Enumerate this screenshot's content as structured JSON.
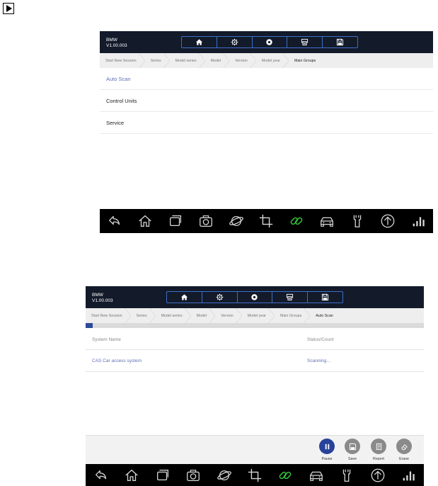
{
  "screens": [
    {
      "brand": {
        "name": "BMW",
        "version": "V1.00.003"
      },
      "toolbar": [
        "home-icon",
        "settings-icon",
        "record-icon",
        "print-icon",
        "save-icon"
      ],
      "breadcrumb": [
        "Start New Session",
        "Series",
        "Model series",
        "Model",
        "Version",
        "Model year",
        "Main Groups"
      ],
      "menu": [
        {
          "label": "Auto Scan",
          "active": true
        },
        {
          "label": "Control Units",
          "active": false
        },
        {
          "label": "Service",
          "active": false
        }
      ]
    },
    {
      "brand": {
        "name": "BMW",
        "version": "V1.00.003"
      },
      "toolbar": [
        "home-icon",
        "settings-icon",
        "record-icon",
        "print-icon",
        "save-icon"
      ],
      "breadcrumb": [
        "Start New Session",
        "Series",
        "Model series",
        "Model",
        "Version",
        "Model year",
        "Main Groups",
        "Auto Scan"
      ],
      "progress": 0.02,
      "table": {
        "headers": [
          "System Name",
          "Status/Count"
        ],
        "rows": [
          {
            "name": "CAS Car access system",
            "status": "Scanning..."
          }
        ]
      },
      "actions": [
        "Pause",
        "Save",
        "Report",
        "Erase"
      ]
    }
  ],
  "nav_icons": [
    "back-icon",
    "home-outline-icon",
    "recent-apps-icon",
    "camera-icon",
    "browser-icon",
    "crop-icon",
    "link-icon",
    "car-icon",
    "wrench-icon",
    "upload-icon",
    "signal-bars-icon"
  ],
  "colors": {
    "topbar": "#131a2a",
    "accent": "#5e70b5",
    "toolbar_border": "#3d6fc7",
    "progress": "#2b4a9a",
    "link_icon": "#35c33a"
  }
}
